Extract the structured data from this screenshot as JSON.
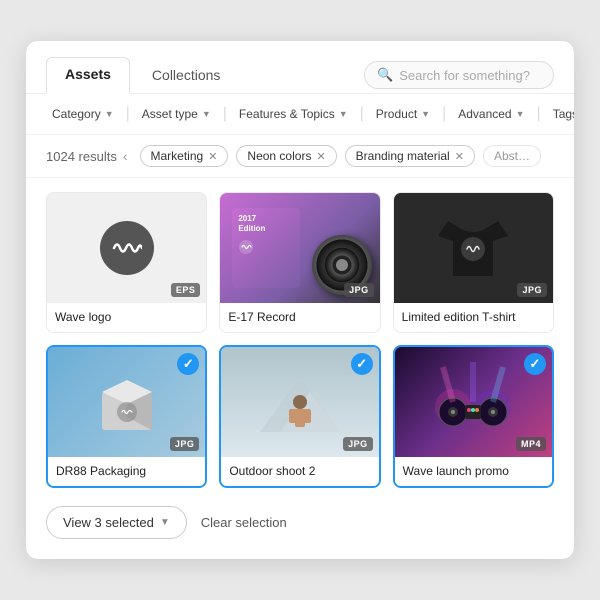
{
  "tabs": {
    "assets_label": "Assets",
    "collections_label": "Collections"
  },
  "search": {
    "placeholder": "Search for something?"
  },
  "filters": {
    "category": "Category",
    "asset_type": "Asset type",
    "features_topics": "Features & Topics",
    "product": "Product",
    "advanced": "Advanced",
    "tags": "Tags"
  },
  "results": {
    "count": "1024 results"
  },
  "chips": [
    {
      "label": "Marketing",
      "id": "marketing"
    },
    {
      "label": "Neon colors",
      "id": "neon-colors"
    },
    {
      "label": "Branding material",
      "id": "branding"
    },
    {
      "label": "Abst...",
      "id": "abstract",
      "fade": true
    }
  ],
  "cards": [
    {
      "id": "wave-logo",
      "label": "Wave logo",
      "badge": "EPS",
      "selected": false,
      "thumb_type": "logo"
    },
    {
      "id": "e17-record",
      "label": "E-17 Record",
      "badge": "JPG",
      "selected": false,
      "thumb_type": "vinyl"
    },
    {
      "id": "limited-tshirt",
      "label": "Limited edition T-shirt",
      "badge": "JPG",
      "selected": false,
      "thumb_type": "tshirt"
    },
    {
      "id": "dr88-packaging",
      "label": "DR88 Packaging",
      "badge": "JPG",
      "selected": true,
      "thumb_type": "box"
    },
    {
      "id": "outdoor-shoot",
      "label": "Outdoor shoot 2",
      "badge": "JPG",
      "selected": true,
      "thumb_type": "outdoor"
    },
    {
      "id": "wave-launch-promo",
      "label": "Wave launch promo",
      "badge": "MP4",
      "selected": true,
      "thumb_type": "promo"
    }
  ],
  "footer": {
    "view_selected": "View 3 selected",
    "clear_selection": "Clear selection"
  }
}
